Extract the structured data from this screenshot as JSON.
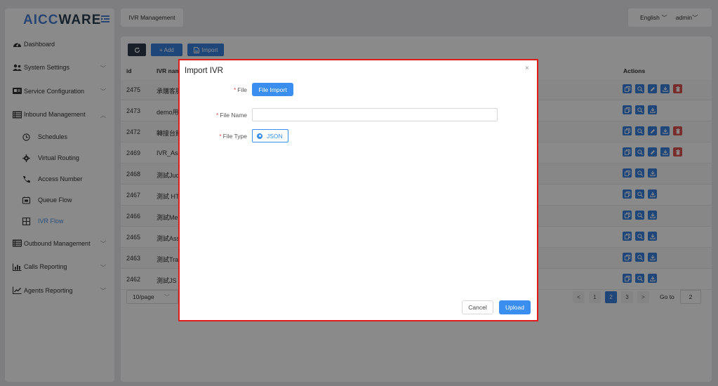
{
  "brand": {
    "logo_part1": "AICC",
    "logo_part2": "WARE"
  },
  "sidebar": {
    "items": [
      {
        "label": "Dashboard",
        "icon": "dashboard-icon"
      },
      {
        "label": "System Settings",
        "icon": "users-icon",
        "chevron": "﹀"
      },
      {
        "label": "Service Configuration",
        "icon": "id-card-icon",
        "chevron": "﹀"
      },
      {
        "label": "Inbound Management",
        "icon": "list-icon",
        "chevron": "︿"
      },
      {
        "label": "Schedules",
        "icon": "clock-icon"
      },
      {
        "label": "Virtual Routing",
        "icon": "gear-icon"
      },
      {
        "label": "Access Number",
        "icon": "phone-icon"
      },
      {
        "label": "Queue Flow",
        "icon": "queue-icon"
      },
      {
        "label": "IVR Flow",
        "icon": "ivr-icon"
      },
      {
        "label": "Outbound Management",
        "icon": "list-icon",
        "chevron": "﹀"
      },
      {
        "label": "Calls Reporting",
        "icon": "bar-chart-icon",
        "chevron": "﹀"
      },
      {
        "label": "Agents Reporting",
        "icon": "line-chart-icon",
        "chevron": "﹀"
      }
    ]
  },
  "header": {
    "tab_label": "IVR Management",
    "language": "English",
    "language_chevron": "﹀",
    "user": "admin",
    "user_chevron": "﹀"
  },
  "toolbar": {
    "refresh_icon": "refresh-icon",
    "add_label": "+ Add",
    "import_label": "Import"
  },
  "table": {
    "headers": {
      "id": "id",
      "name": "IVR nam",
      "actions": "Actions"
    },
    "rows": [
      {
        "id": "2475",
        "name": "承購客服",
        "actions": [
          "copy",
          "search",
          "edit",
          "download",
          "delete"
        ]
      },
      {
        "id": "2473",
        "name": "demo用",
        "actions": [
          "copy",
          "search",
          "download"
        ]
      },
      {
        "id": "2472",
        "name": "轉接台館",
        "actions": [
          "copy",
          "search",
          "edit",
          "download",
          "delete"
        ]
      },
      {
        "id": "2469",
        "name": "IVR_Assi",
        "actions": [
          "copy",
          "search",
          "edit",
          "download",
          "delete"
        ]
      },
      {
        "id": "2468",
        "name": "測試Judi",
        "actions": [
          "copy",
          "search",
          "download"
        ]
      },
      {
        "id": "2467",
        "name": "測試 HT",
        "actions": [
          "copy",
          "search",
          "download"
        ]
      },
      {
        "id": "2466",
        "name": "測試Mer",
        "actions": [
          "copy",
          "search",
          "download"
        ]
      },
      {
        "id": "2465",
        "name": "測試Assi",
        "actions": [
          "copy",
          "search",
          "download"
        ]
      },
      {
        "id": "2463",
        "name": "測試Tran",
        "actions": [
          "copy",
          "search",
          "download"
        ]
      },
      {
        "id": "2462",
        "name": "測試JS",
        "actions": [
          "copy",
          "search",
          "download"
        ]
      }
    ]
  },
  "pagination": {
    "page_size": "10/page",
    "page_size_chevron": "﹀",
    "prev": "<",
    "next": ">",
    "pages": [
      "1",
      "2",
      "3"
    ],
    "current_page": "2",
    "goto_label": "Go to",
    "goto_value": "2"
  },
  "modal": {
    "title": "Import IVR",
    "close": "×",
    "file_label": "File",
    "file_button": "File Import",
    "file_name_label": "File Name",
    "file_name_value": "",
    "file_type_label": "File Type",
    "file_type_option": "JSON",
    "required_mark": "*",
    "cancel_label": "Cancel",
    "upload_label": "Upload"
  },
  "colors": {
    "primary": "#3a8ef0",
    "danger": "#e05252",
    "highlight_border": "#e01b1b"
  }
}
